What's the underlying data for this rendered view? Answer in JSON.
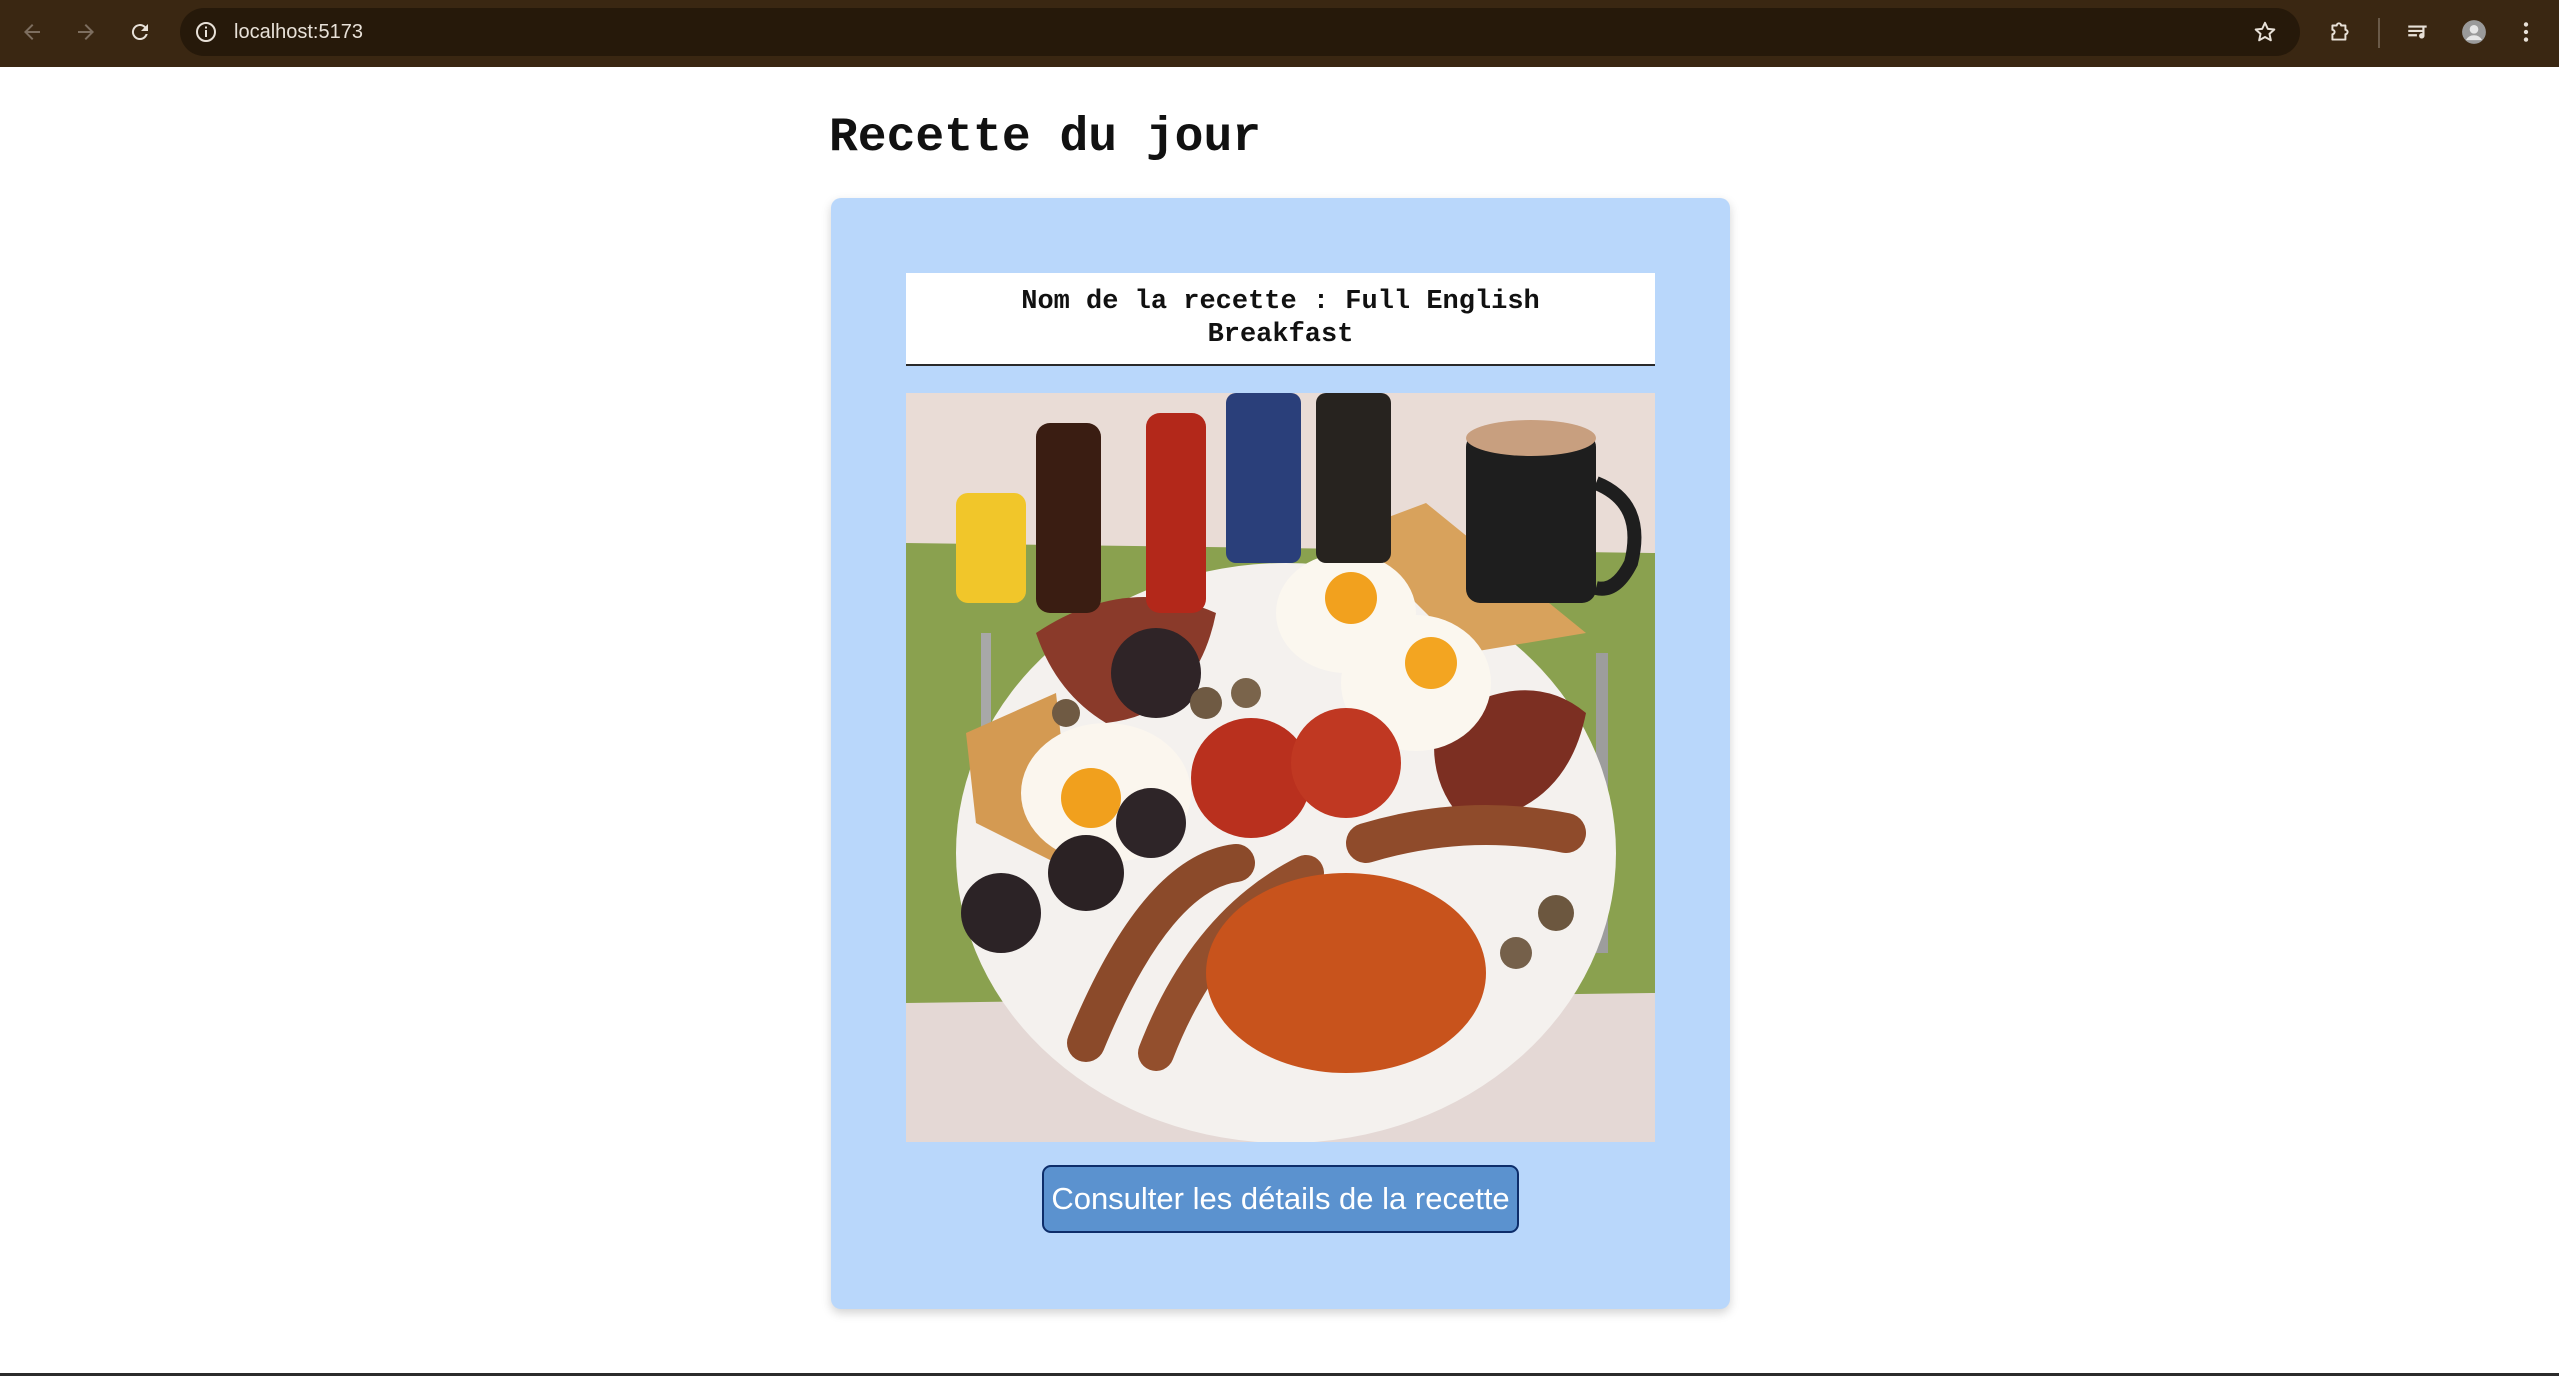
{
  "browser": {
    "url": "localhost:5173",
    "theme_color": "#3a2712"
  },
  "page": {
    "title": "Recette du jour"
  },
  "recipe_card": {
    "name_text": "Nom de la recette : Full English Breakfast",
    "image_alt": "Full English Breakfast",
    "button_label": "Consulter les détails de la recette",
    "card_color": "#b9d7fb",
    "button_color": "#5b92cf"
  },
  "icons": {
    "back": "arrow-left-icon",
    "forward": "arrow-right-icon",
    "reload": "reload-icon",
    "site_info": "info-icon",
    "bookmark": "star-icon",
    "extensions": "puzzle-icon",
    "media": "media-queue-icon",
    "profile": "avatar-icon",
    "menu": "kebab-menu-icon"
  }
}
